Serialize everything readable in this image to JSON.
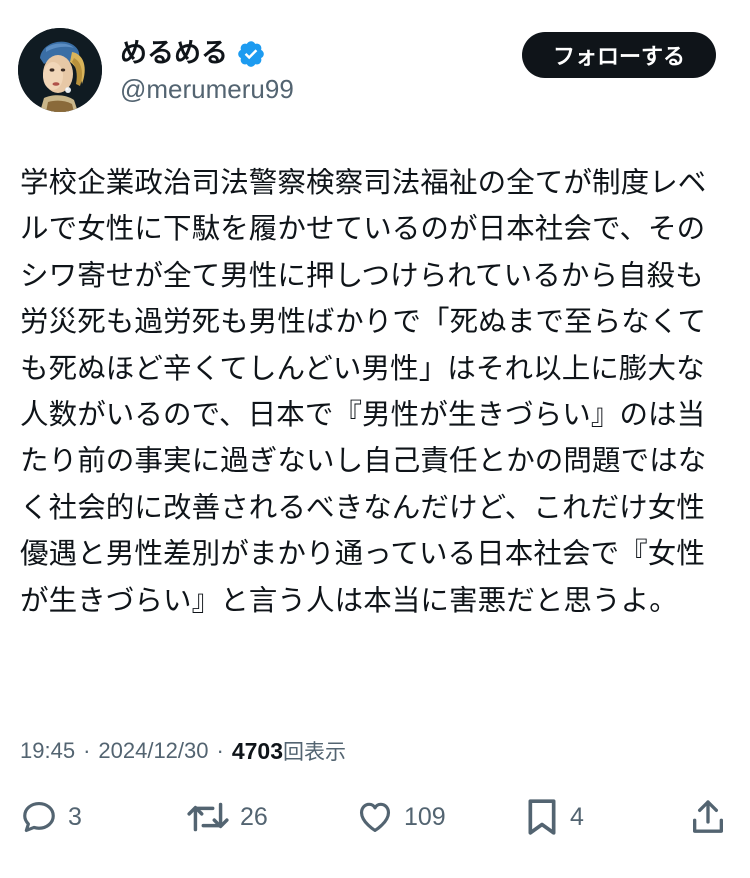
{
  "user": {
    "display_name": "めるめる",
    "handle": "@merumeru99",
    "verified": true
  },
  "follow_button": {
    "label": "フォローする"
  },
  "tweet": {
    "text": "学校企業政治司法警察検察司法福祉の全てが制度レベルで女性に下駄を履かせているのが日本社会で、そのシワ寄せが全て男性に押しつけられているから自殺も労災死も過労死も男性ばかりで「死ぬまで至らなくても死ぬほど辛くてしんどい男性」はそれ以上に膨大な人数がいるので、日本で『男性が生きづらい』のは当たり前の事実に過ぎないし自己責任とかの問題ではなく社会的に改善されるべきなんだけど、これだけ女性優遇と男性差別がまかり通っている日本社会で『女性が生きづらい』と言う人は本当に害悪だと思うよ。"
  },
  "meta": {
    "time": "19:45",
    "date": "2024/12/30",
    "dot": "·",
    "views_count": "4703",
    "views_label": "回表示"
  },
  "actions": {
    "reply": {
      "icon": "reply-icon",
      "count": "3"
    },
    "retweet": {
      "icon": "retweet-icon",
      "count": "26"
    },
    "like": {
      "icon": "heart-icon",
      "count": "109"
    },
    "bookmark": {
      "icon": "bookmark-icon",
      "count": "4"
    },
    "share": {
      "icon": "share-icon"
    }
  },
  "colors": {
    "text": "#0f1419",
    "secondary": "#536471",
    "verified": "#1d9bf0",
    "button_bg": "#0f1419",
    "button_text": "#ffffff"
  }
}
